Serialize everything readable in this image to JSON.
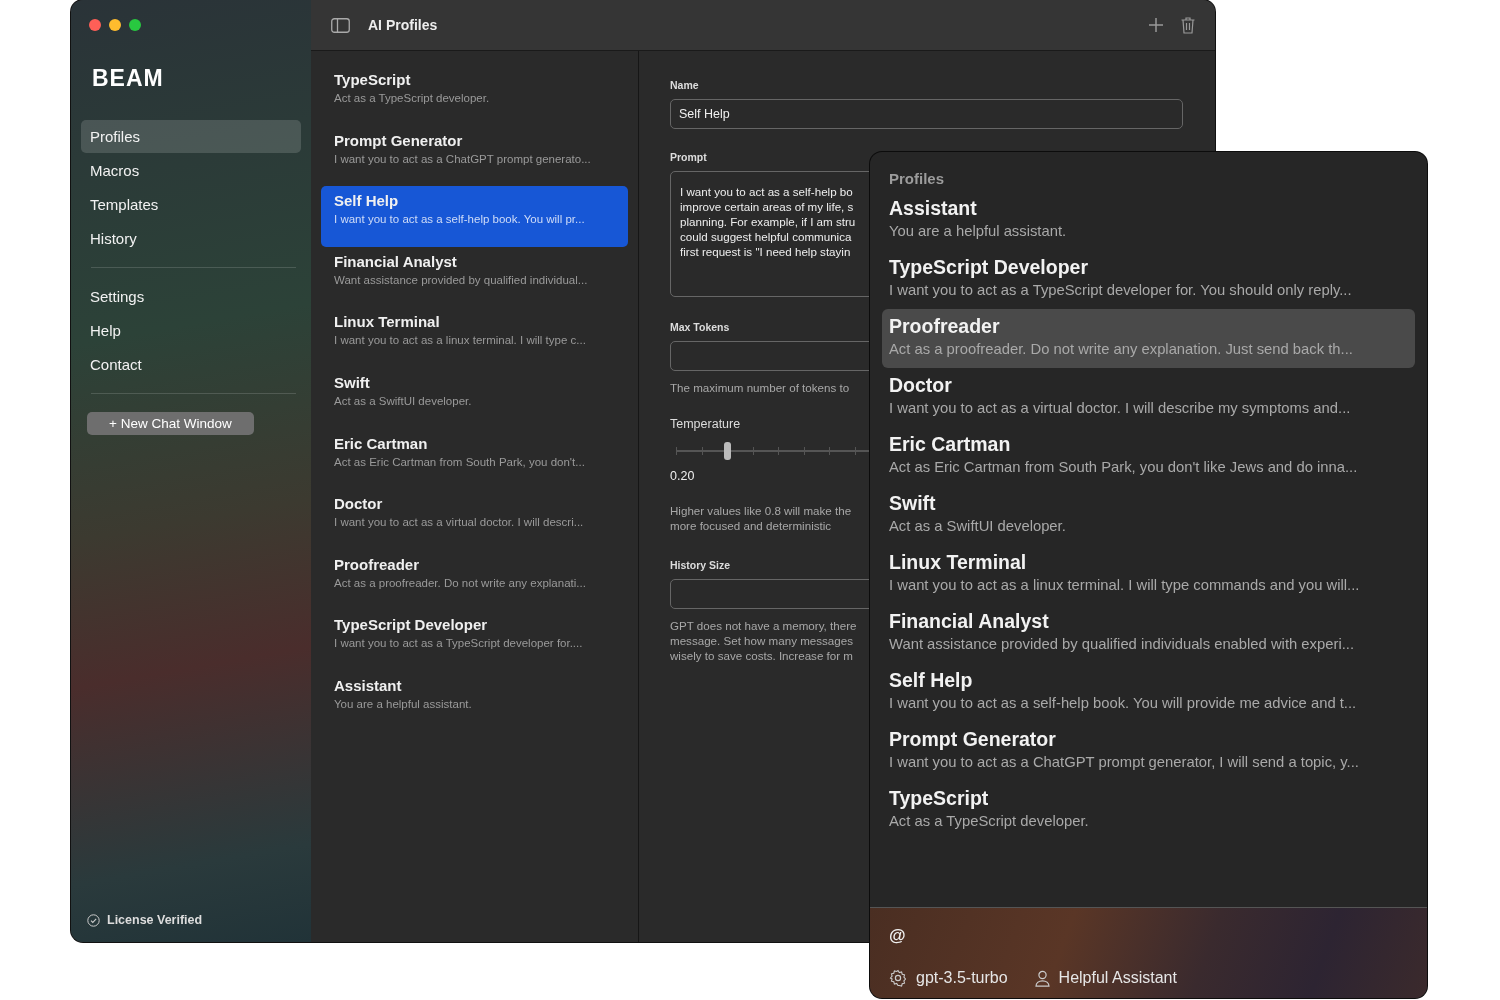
{
  "window": {
    "title": "AI Profiles"
  },
  "sidebar": {
    "logo": "BEAM",
    "primary": [
      {
        "label": "Profiles",
        "selected": true
      },
      {
        "label": "Macros",
        "selected": false
      },
      {
        "label": "Templates",
        "selected": false
      },
      {
        "label": "History",
        "selected": false
      }
    ],
    "secondary": [
      {
        "label": "Settings",
        "selected": false
      },
      {
        "label": "Help",
        "selected": false
      },
      {
        "label": "Contact",
        "selected": false
      }
    ],
    "new_chat_button": "+ New Chat Window",
    "status": "License Verified"
  },
  "profiles": [
    {
      "name": "TypeScript",
      "description": "Act as a TypeScript developer.",
      "selected": false
    },
    {
      "name": "Prompt Generator",
      "description": "I want you to act as a ChatGPT prompt generato...",
      "selected": false
    },
    {
      "name": "Self Help",
      "description": "I want you to act as a self-help book. You will pr...",
      "selected": true
    },
    {
      "name": "Financial Analyst",
      "description": "Want assistance provided by qualified individual...",
      "selected": false
    },
    {
      "name": "Linux Terminal",
      "description": "I want you to act as a linux terminal. I will type c...",
      "selected": false
    },
    {
      "name": "Swift",
      "description": "Act as a SwiftUI developer.",
      "selected": false
    },
    {
      "name": "Eric Cartman",
      "description": "Act as Eric Cartman from South Park, you don't...",
      "selected": false
    },
    {
      "name": "Doctor",
      "description": "I want you to act as a virtual doctor. I will descri...",
      "selected": false
    },
    {
      "name": "Proofreader",
      "description": "Act as a proofreader. Do not write any explanati...",
      "selected": false
    },
    {
      "name": "TypeScript Developer",
      "description": "I want you to act as a TypeScript developer for....",
      "selected": false
    },
    {
      "name": "Assistant",
      "description": "You are a helpful assistant.",
      "selected": false
    }
  ],
  "editor": {
    "name_label": "Name",
    "name_value": "Self Help",
    "prompt_label": "Prompt",
    "prompt_value": "I want you to act as a self-help bo\nimprove certain areas of my life, s\nplanning. For example, if I am stru\ncould suggest helpful communica\nfirst request is \"I need help stayin",
    "max_tokens_label": "Max Tokens",
    "max_tokens_hint": "The maximum number of tokens to",
    "temperature_label": "Temperature",
    "temperature": {
      "level": 0.2,
      "reading": "0.20"
    },
    "temperature_hint": "Higher values like 0.8 will make the\nmore focused and deterministic",
    "history_label": "History Size",
    "history_hint": "GPT does not have a memory, there\nmessage. Set how many messages\nwisely to save costs. Increase for m"
  },
  "popup": {
    "heading": "Profiles",
    "items": [
      {
        "name": "Assistant",
        "description": "You are a helpful assistant.",
        "selected": false
      },
      {
        "name": "TypeScript Developer",
        "description": "I want you to act as a TypeScript developer for. You should only reply...",
        "selected": false
      },
      {
        "name": "Proofreader",
        "description": "Act as a proofreader. Do not write any explanation. Just send back th...",
        "selected": true
      },
      {
        "name": "Doctor",
        "description": "I want you to act as a virtual doctor. I will describe my symptoms and...",
        "selected": false
      },
      {
        "name": "Eric Cartman",
        "description": "Act as Eric Cartman from South Park, you don't like Jews and do inna...",
        "selected": false
      },
      {
        "name": "Swift",
        "description": "Act as a SwiftUI developer.",
        "selected": false
      },
      {
        "name": "Linux Terminal",
        "description": "I want you to act as a linux terminal. I will type commands and you will...",
        "selected": false
      },
      {
        "name": "Financial Analyst",
        "description": "Want assistance provided by qualified individuals enabled with experi...",
        "selected": false
      },
      {
        "name": "Self Help",
        "description": "I want you to act as a self-help book. You will provide me advice and t...",
        "selected": false
      },
      {
        "name": "Prompt Generator",
        "description": "I want you to act as a ChatGPT prompt generator, I will send a topic, y...",
        "selected": false
      },
      {
        "name": "TypeScript",
        "description": "Act as a TypeScript developer.",
        "selected": false
      }
    ],
    "input_value": "@",
    "model": "gpt-3.5-turbo",
    "profile": "Helpful Assistant"
  }
}
